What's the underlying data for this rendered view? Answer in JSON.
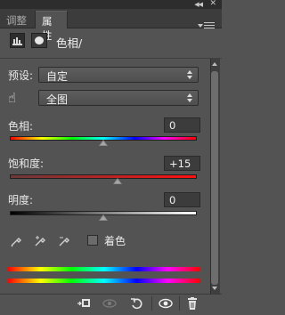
{
  "tabs": [
    {
      "label": "调整"
    },
    {
      "label": "属性"
    }
  ],
  "header": {
    "title": "色相/"
  },
  "preset": {
    "label": "预设:",
    "value": "自定"
  },
  "channel": {
    "value": "全图"
  },
  "sliders": [
    {
      "label": "色相:",
      "value": "0",
      "level": 0.5
    },
    {
      "label": "饱和度:",
      "value": "+15",
      "level": 0.575
    },
    {
      "label": "明度:",
      "value": "0",
      "level": 0.5
    }
  ],
  "colorize": {
    "label": "着色",
    "checked": false
  },
  "icons": {
    "adjust_layer": "levels-adjustment-icon",
    "mask": "layer-mask-icon",
    "hand": "targeted-adjustment-hand-icon",
    "eyedroppers": [
      "eyedropper-icon",
      "eyedropper-add-icon",
      "eyedropper-subtract-icon"
    ],
    "bottom": [
      "clip-to-layer-icon",
      "view-previous-state-icon",
      "reset-icon",
      "visibility-eye-icon",
      "trash-icon"
    ]
  },
  "colors": {
    "panel_bg": "#535353",
    "tabbar_bg": "#3c3c3c",
    "saturation_end": "#ff1010"
  }
}
